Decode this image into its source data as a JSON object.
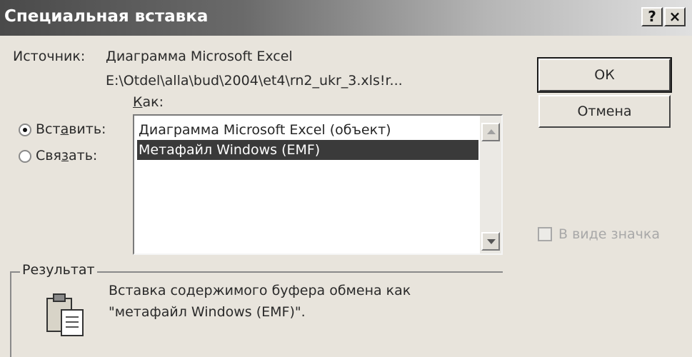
{
  "dialog": {
    "title": "Специальная вставка",
    "help_button": "?",
    "close_button": "×"
  },
  "source": {
    "label": "Источник:",
    "name": "Диаграмма Microsoft Excel",
    "path": "E:\\Otdel\\alla\\bud\\2004\\et4\\rn2_ukr_3.xls!r..."
  },
  "as_label": {
    "hotkey": "К",
    "rest": "ак:"
  },
  "mode": {
    "paste": {
      "pre": "Вст",
      "hotkey": "а",
      "post": "вить:",
      "selected": true
    },
    "link": {
      "pre": "Свя",
      "hotkey": "з",
      "post": "ать:",
      "selected": false
    }
  },
  "formats": {
    "items": [
      {
        "label": "Диаграмма Microsoft Excel (объект)",
        "selected": false
      },
      {
        "label": "Метафайл Windows (EMF)",
        "selected": true
      }
    ]
  },
  "buttons": {
    "ok": "ОК",
    "cancel": "Отмена"
  },
  "as_icon": {
    "label": "В виде значка",
    "checked": false,
    "enabled": false
  },
  "result": {
    "legend": "Результат",
    "line1": "Вставка содержимого буфера обмена как",
    "line2": "\"метафайл Windows (EMF)\"."
  },
  "icons": {
    "result_icon": "clipboard-paste-icon",
    "scroll_up": "scroll-up-arrow-icon",
    "scroll_down": "scroll-down-arrow-icon"
  }
}
